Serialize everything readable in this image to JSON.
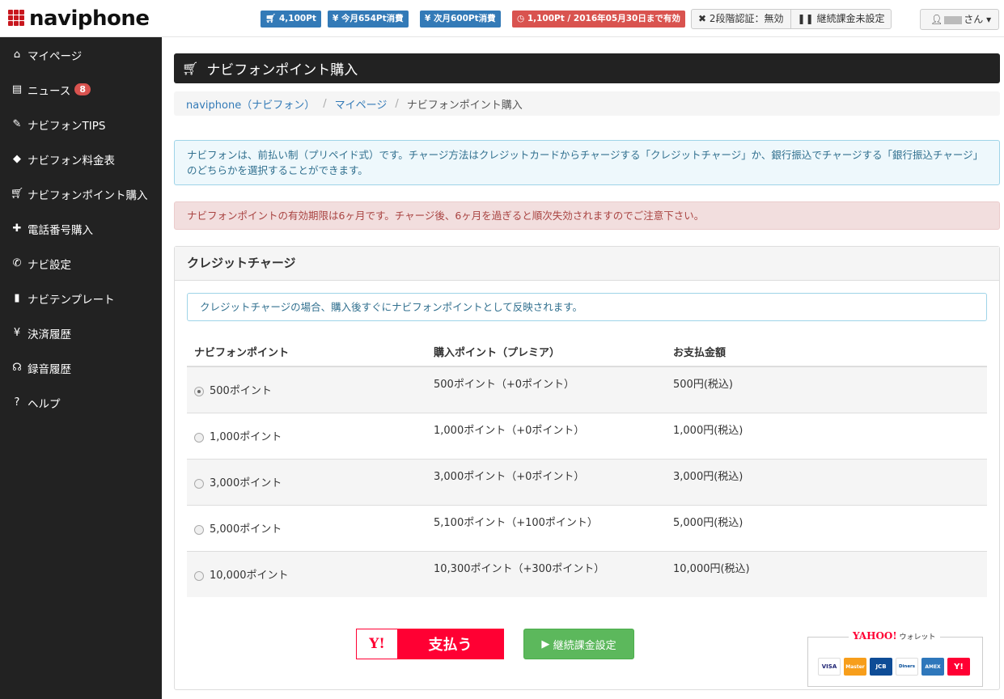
{
  "brand": "naviphone",
  "topbar": {
    "badges": [
      {
        "icon": "cart-icon",
        "text": "4,100Pt",
        "color": "#337ab7"
      },
      {
        "icon": "yen-icon",
        "text": "今月654Pt消費",
        "color": "#337ab7"
      },
      {
        "icon": "yen-icon",
        "text": "次月600Pt消費",
        "color": "#337ab7"
      },
      {
        "icon": "clock-icon",
        "text": "1,100Pt / 2016年05月30日まで有効",
        "color": "#d9534f"
      }
    ],
    "two_factor": "2段階認証：無効",
    "subscription": "継続課金未設定",
    "user_suffix": "さん"
  },
  "sidebar": {
    "items": [
      {
        "icon": "home-icon",
        "label": "マイページ"
      },
      {
        "icon": "news-icon",
        "label": "ニュース",
        "badge": "8"
      },
      {
        "icon": "pencil-icon",
        "label": "ナビフォンTIPS"
      },
      {
        "icon": "tag-icon",
        "label": "ナビフォン料金表"
      },
      {
        "icon": "cart-icon",
        "label": "ナビフォンポイント購入"
      },
      {
        "icon": "plus-icon",
        "label": "電話番号購入"
      },
      {
        "icon": "phone-icon",
        "label": "ナビ設定"
      },
      {
        "icon": "file-icon",
        "label": "ナビテンプレート"
      },
      {
        "icon": "yen-icon",
        "label": "決済履歴"
      },
      {
        "icon": "headphones-icon",
        "label": "録音履歴"
      },
      {
        "icon": "question-icon",
        "label": "ヘルプ"
      }
    ]
  },
  "page": {
    "title": "ナビフォンポイント購入",
    "breadcrumb": [
      "naviphone（ナビフォン）",
      "マイページ",
      "ナビフォンポイント購入"
    ],
    "info": "ナビフォンは、前払い制（プリペイド式）です。チャージ方法はクレジットカードからチャージする「クレジットチャージ」か、銀行振込でチャージする「銀行振込チャージ」のどちらかを選択することができます。",
    "warning": "ナビフォンポイントの有効期限は6ヶ月です。チャージ後、6ヶ月を過ぎると順次失効されますのでご注意下さい。"
  },
  "panel": {
    "title": "クレジットチャージ",
    "note": "クレジットチャージの場合、購入後すぐにナビフォンポイントとして反映されます。",
    "headers": [
      "ナビフォンポイント",
      "購入ポイント（プレミア）",
      "お支払金額"
    ],
    "rows": [
      {
        "points": "500ポイント",
        "premium": "500ポイント（+0ポイント）",
        "price": "500円(税込)",
        "selected": true
      },
      {
        "points": "1,000ポイント",
        "premium": "1,000ポイント（+0ポイント）",
        "price": "1,000円(税込)",
        "selected": false
      },
      {
        "points": "3,000ポイント",
        "premium": "3,000ポイント（+0ポイント）",
        "price": "3,000円(税込)",
        "selected": false
      },
      {
        "points": "5,000ポイント",
        "premium": "5,100ポイント（+100ポイント）",
        "price": "5,000円(税込)",
        "selected": false
      },
      {
        "points": "10,000ポイント",
        "premium": "10,300ポイント（+300ポイント）",
        "price": "10,000円(税込)",
        "selected": false
      }
    ],
    "pay_logo": "Y!",
    "pay_label": "支払う",
    "subscribe_label": "継続課金設定",
    "wallet_brand": "YAHOO!",
    "wallet_label": "ウォレット",
    "cards": [
      "VISA",
      "Master",
      "JCB",
      "Diners",
      "AMEX",
      "Y!"
    ]
  },
  "colors": {
    "sidebar_bg": "#222222",
    "accent_blue": "#337ab7",
    "danger": "#d9534f",
    "success": "#5cb85c",
    "yahoo_red": "#ff0033"
  }
}
